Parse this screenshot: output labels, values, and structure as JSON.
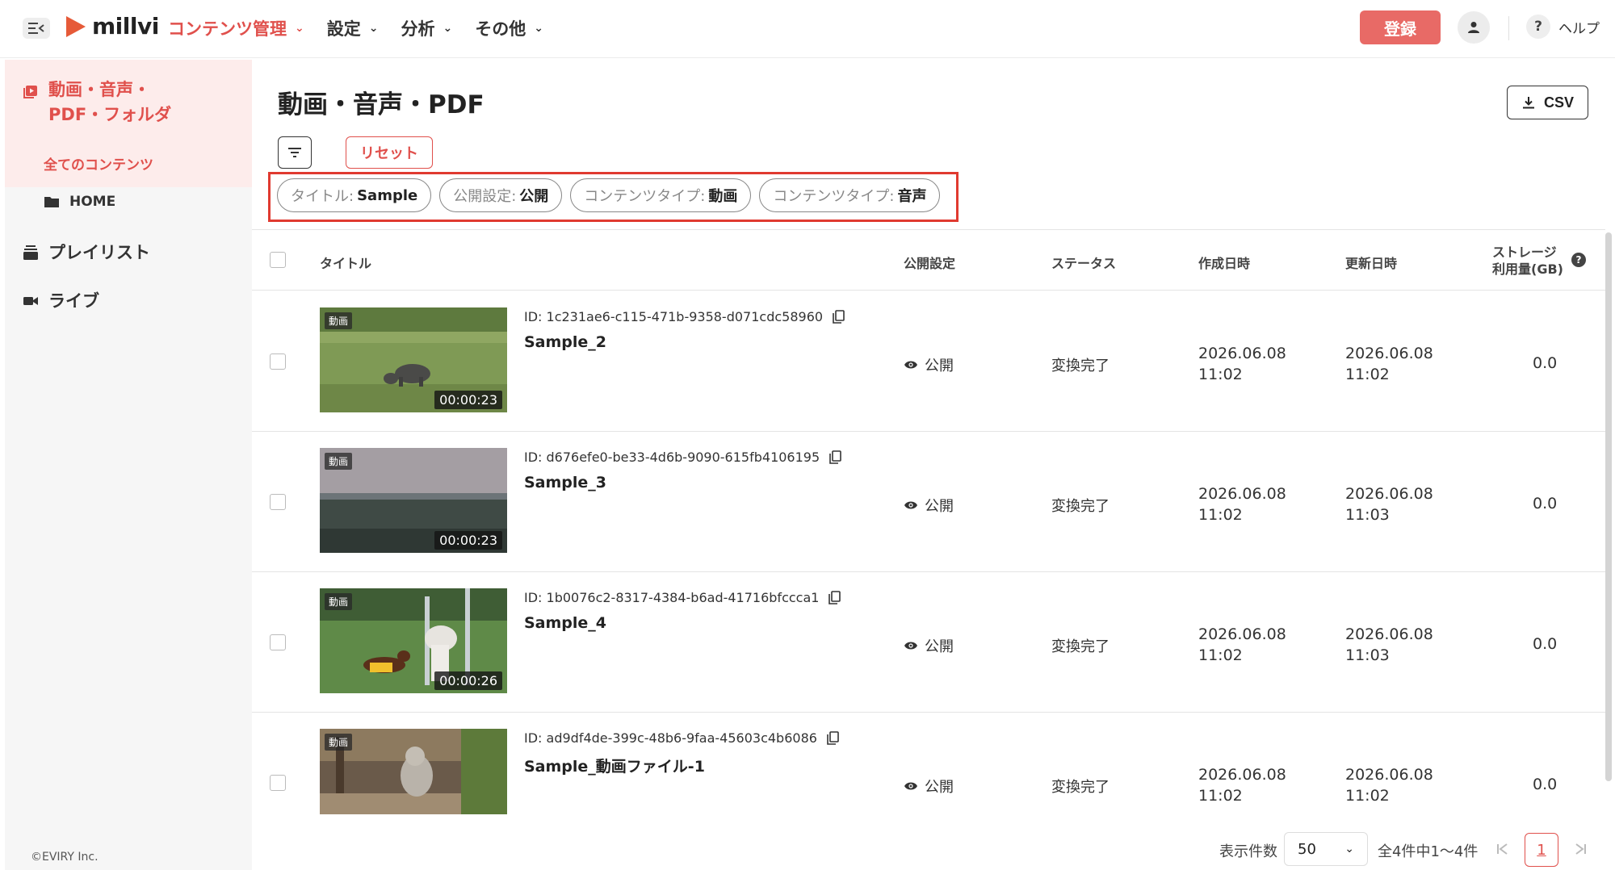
{
  "header": {
    "logo_text": "millvi",
    "nav": [
      {
        "label": "コンテンツ管理",
        "active": true
      },
      {
        "label": "設定",
        "active": false
      },
      {
        "label": "分析",
        "active": false
      },
      {
        "label": "その他",
        "active": false
      }
    ],
    "register_label": "登録",
    "help_label": "ヘルプ",
    "help_icon_text": "?"
  },
  "sidebar": {
    "main_items": [
      {
        "label_line1": "動画・音声・",
        "label_line2": "PDF・フォルダ",
        "active": true
      },
      {
        "label": "プレイリスト"
      },
      {
        "label": "ライブ"
      }
    ],
    "sub_all": "全てのコンテンツ",
    "folder_home": "HOME",
    "footer": "©EVIRY Inc."
  },
  "main": {
    "title": "動画・音声・PDF",
    "csv_label": "CSV",
    "reset_label": "リセット",
    "chips": [
      {
        "key": "タイトル:",
        "value": "Sample"
      },
      {
        "key": "公開設定:",
        "value": "公開"
      },
      {
        "key": "コンテンツタイプ:",
        "value": "動画"
      },
      {
        "key": "コンテンツタイプ:",
        "value": "音声"
      }
    ]
  },
  "table": {
    "headers": {
      "title": "タイトル",
      "publish": "公開設定",
      "status": "ステータス",
      "created": "作成日時",
      "updated": "更新日時",
      "storage_line1": "ストレージ",
      "storage_line2": "利用量(GB)"
    },
    "rows": [
      {
        "tag": "動画",
        "duration": "00:00:23",
        "id": "ID: 1c231ae6-c115-471b-9358-d071cdc58960",
        "name": "Sample_2",
        "publish": "公開",
        "status": "変換完了",
        "created_date": "2026.06.08",
        "created_time": "11:02",
        "updated_date": "2026.06.08",
        "updated_time": "11:02",
        "storage": "0.0"
      },
      {
        "tag": "動画",
        "duration": "00:00:23",
        "id": "ID: d676efe0-be33-4d6b-9090-615fb4106195",
        "name": "Sample_3",
        "publish": "公開",
        "status": "変換完了",
        "created_date": "2026.06.08",
        "created_time": "11:02",
        "updated_date": "2026.06.08",
        "updated_time": "11:03",
        "storage": "0.0"
      },
      {
        "tag": "動画",
        "duration": "00:00:26",
        "id": "ID: 1b0076c2-8317-4384-b6ad-41716bfccca1",
        "name": "Sample_4",
        "publish": "公開",
        "status": "変換完了",
        "created_date": "2026.06.08",
        "created_time": "11:02",
        "updated_date": "2026.06.08",
        "updated_time": "11:03",
        "storage": "0.0"
      },
      {
        "tag": "動画",
        "duration": "",
        "id": "ID: ad9df4de-399c-48b6-9faa-45603c4b6086",
        "name": "Sample_動画ファイル-1",
        "publish": "公開",
        "status": "変換完了",
        "created_date": "2026.06.08",
        "created_time": "11:02",
        "updated_date": "2026.06.08",
        "updated_time": "11:02",
        "storage": "0.0"
      }
    ]
  },
  "pagination": {
    "per_page_label": "表示件数",
    "per_page_value": "50",
    "info": "全4件中1〜4件",
    "current_page": "1"
  },
  "colors": {
    "accent": "#e0504c",
    "register_bg": "#e86a66",
    "highlight_border": "#e03a30",
    "sidebar_bg": "#f6f6f6",
    "sidebar_active_bg": "#fdeceb"
  },
  "icons": [
    "menu-collapse-icon",
    "play-logo-icon",
    "chevron-down-icon",
    "user-icon",
    "video-library-icon",
    "folder-icon",
    "playlist-icon",
    "video-camera-icon",
    "download-icon",
    "filter-icon",
    "copy-icon",
    "eye-icon",
    "help-icon",
    "first-page-icon",
    "last-page-icon"
  ]
}
